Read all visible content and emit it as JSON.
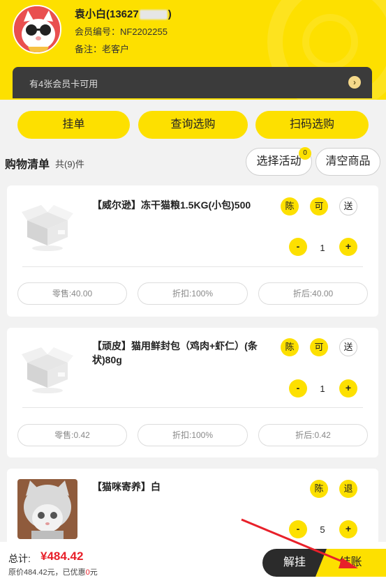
{
  "header": {
    "member_name_prefix": "袁小白(13627",
    "member_name_suffix": ")",
    "member_no": "会员编号：NF2202255",
    "note": "备注：老客户"
  },
  "card_bar": {
    "text": "有4张会员卡可用",
    "icon": "chevron-right-icon"
  },
  "actions": {
    "hang_list": "挂单",
    "query_select": "查询选购",
    "scan_select": "扫码选购"
  },
  "cart": {
    "title": "购物清单",
    "count": "共(9)件",
    "select_activity": "选择活动",
    "activity_badge": "0",
    "clear_goods": "清空商品"
  },
  "items": [
    {
      "name": "【威尔逊】冻干猫粮1.5KG(小包)500",
      "tags": [
        "陈",
        "可",
        "送"
      ],
      "minus": "-",
      "qty": "1",
      "plus": "+",
      "retail": "零售:40.00",
      "discount": "折扣:100%",
      "after": "折后:40.00"
    },
    {
      "name_line1": "【顽皮】猫用鲜封包（鸡肉+虾仁）(条",
      "name_line2": "状)80g",
      "tags": [
        "陈",
        "可",
        "送"
      ],
      "minus": "-",
      "qty": "1",
      "plus": "+",
      "retail": "零售:0.42",
      "discount": "折扣:100%",
      "after": "折后:0.42"
    },
    {
      "name": "【猫咪寄养】白",
      "tags": [
        "陈",
        "退"
      ],
      "minus": "-",
      "qty": "5",
      "plus": "+"
    }
  ],
  "footer": {
    "total_label": "总计:",
    "total_value": "¥484.42",
    "orig_prefix": "原价484.42元，已优惠",
    "discount_value": "0",
    "discount_unit": "元",
    "hang_button": "解挂",
    "checkout_button": "结账"
  },
  "colors": {
    "accent": "#fde000",
    "dark": "#2b2b2b",
    "price_red": "#e8202a",
    "annotation_arrow": "#e8202a"
  }
}
